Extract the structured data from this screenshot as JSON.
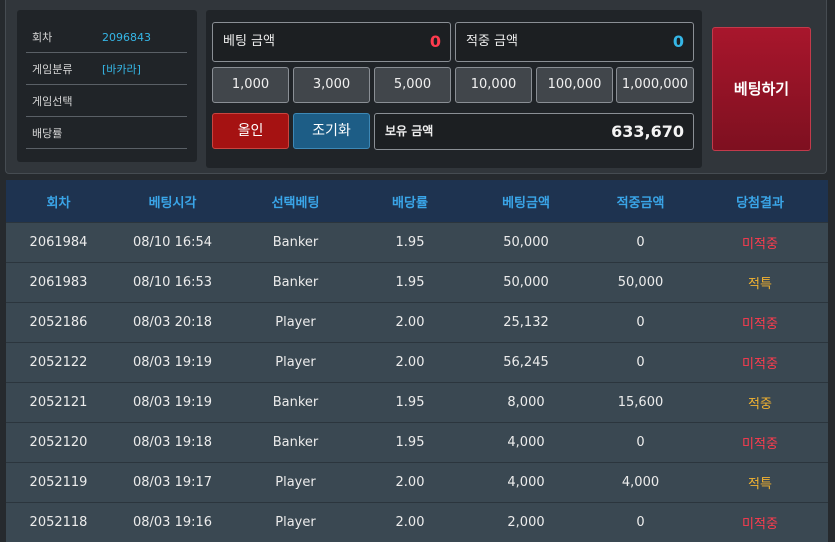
{
  "info": {
    "rows": [
      {
        "label": "회차",
        "value": "2096843"
      },
      {
        "label": "게임분류",
        "value": "[바카라]"
      },
      {
        "label": "게임선택",
        "value": ""
      },
      {
        "label": "배당률",
        "value": ""
      }
    ]
  },
  "bet": {
    "bet_amount_label": "베팅 금액",
    "bet_amount_value": "0",
    "win_amount_label": "적중 금액",
    "win_amount_value": "0",
    "chips": [
      "1,000",
      "3,000",
      "5,000",
      "10,000",
      "100,000",
      "1,000,000"
    ],
    "allin_label": "올인",
    "reset_label": "조기화",
    "balance_label": "보유 금액",
    "balance_value": "633,670",
    "submit_label": "베팅하기"
  },
  "colors": {
    "bet_amount": "#ff3b4e",
    "win_amount": "#35b6e6",
    "result_miss": "#ff3b4e",
    "result_hit": "#f2b230"
  },
  "history": {
    "headers": [
      "회차",
      "베팅시각",
      "선택베팅",
      "배당률",
      "베팅금액",
      "적중금액",
      "당첨결과"
    ],
    "rows": [
      [
        "2061984",
        "08/10 16:54",
        "Banker",
        "1.95",
        "50,000",
        "0",
        "미적중"
      ],
      [
        "2061983",
        "08/10 16:53",
        "Banker",
        "1.95",
        "50,000",
        "50,000",
        "적특"
      ],
      [
        "2052186",
        "08/03 20:18",
        "Player",
        "2.00",
        "25,132",
        "0",
        "미적중"
      ],
      [
        "2052122",
        "08/03 19:19",
        "Player",
        "2.00",
        "56,245",
        "0",
        "미적중"
      ],
      [
        "2052121",
        "08/03 19:19",
        "Banker",
        "1.95",
        "8,000",
        "15,600",
        "적중"
      ],
      [
        "2052120",
        "08/03 19:18",
        "Banker",
        "1.95",
        "4,000",
        "0",
        "미적중"
      ],
      [
        "2052119",
        "08/03 19:17",
        "Player",
        "2.00",
        "4,000",
        "4,000",
        "적특"
      ],
      [
        "2052118",
        "08/03 19:16",
        "Player",
        "2.00",
        "2,000",
        "0",
        "미적중"
      ]
    ]
  }
}
